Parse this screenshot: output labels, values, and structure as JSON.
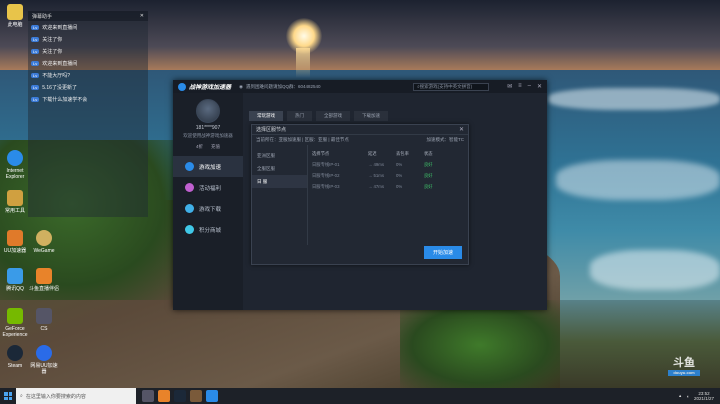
{
  "desktop": {
    "icons": [
      {
        "label": "此电脑",
        "color": "#e8c44a"
      },
      {
        "label": "Internet Explorer",
        "color": "#2a8be8"
      },
      {
        "label": "常用工具",
        "color": "#d0a040"
      },
      {
        "label": "UU加速器",
        "color": "#e07a2a"
      },
      {
        "label": "WeGame",
        "color": "#d0b060"
      },
      {
        "label": "腾讯QQ",
        "color": "#3a9be8"
      },
      {
        "label": "斗鱼直播伴侣",
        "color": "#e8832a"
      },
      {
        "label": "GeForce Experience",
        "color": "#76b900"
      },
      {
        "label": "CS",
        "color": "#556"
      },
      {
        "label": "Steam",
        "color": "#1b2838"
      },
      {
        "label": "网易UU加速器",
        "color": "#2a6be8"
      }
    ]
  },
  "chat": {
    "title": "弹幕助手",
    "rows": [
      {
        "lvl": "Lv",
        "name": "",
        "msg": "欢迎来到直播间"
      },
      {
        "lvl": "Lv",
        "name": "",
        "msg": "关注了你"
      },
      {
        "lvl": "Lv",
        "name": "",
        "msg": "关注了你"
      },
      {
        "lvl": "Lv",
        "name": "",
        "msg": "欢迎来到直播间"
      },
      {
        "lvl": "Lv",
        "name": "",
        "msg": "不能大厅吗?"
      },
      {
        "lvl": "Lv",
        "name": "",
        "msg": "5.16了没更新了"
      },
      {
        "lvl": "Lv",
        "name": "",
        "msg": "下载什么加速学不会"
      }
    ]
  },
  "app": {
    "title": "战神游戏加速器",
    "notice": "遇到困难问题请加QQ群：604482540",
    "search_placeholder": "搜索游戏(支持中英文拼音)",
    "user": {
      "id": "181****907",
      "welcome": "欢迎使用战神游戏加速器",
      "stats": [
        "4折",
        "充值"
      ]
    },
    "nav": [
      {
        "label": "游戏加速",
        "color": "#2a8be8"
      },
      {
        "label": "活动福利",
        "color": "#c060d0"
      },
      {
        "label": "游戏下载",
        "color": "#40b0e8"
      },
      {
        "label": "积分商城",
        "color": "#40c8e8"
      }
    ],
    "tabs": [
      "常玩游戏",
      "热门",
      "全部游戏",
      "下载加速"
    ],
    "dialog": {
      "title": "选择区服节点",
      "info": "当前所在：亚服加速服 | 区服：亚服 | 最佳节点",
      "mode": "加速模式：智能TC",
      "regions": [
        "亚洲区服",
        "全服区服",
        "日 服"
      ],
      "columns": [
        "选择节点",
        "延迟",
        "丢包率",
        "状态"
      ],
      "servers": [
        {
          "name": "日服专线IP-01",
          "ping": "→ 49ms",
          "loss": "0%",
          "status": "良好"
        },
        {
          "name": "日服专线IP-02",
          "ping": "→ 51ms",
          "loss": "0%",
          "status": "良好"
        },
        {
          "name": "日服专线IP-03",
          "ping": "→ 47ms",
          "loss": "0%",
          "status": "良好"
        }
      ],
      "accelerate_label": "开始加速"
    }
  },
  "taskbar": {
    "search_placeholder": "在这里输入你要搜索的内容",
    "time": "23:52",
    "date": "2021/1/27"
  },
  "watermark": {
    "text": "斗鱼",
    "sub": "douyu.com"
  }
}
